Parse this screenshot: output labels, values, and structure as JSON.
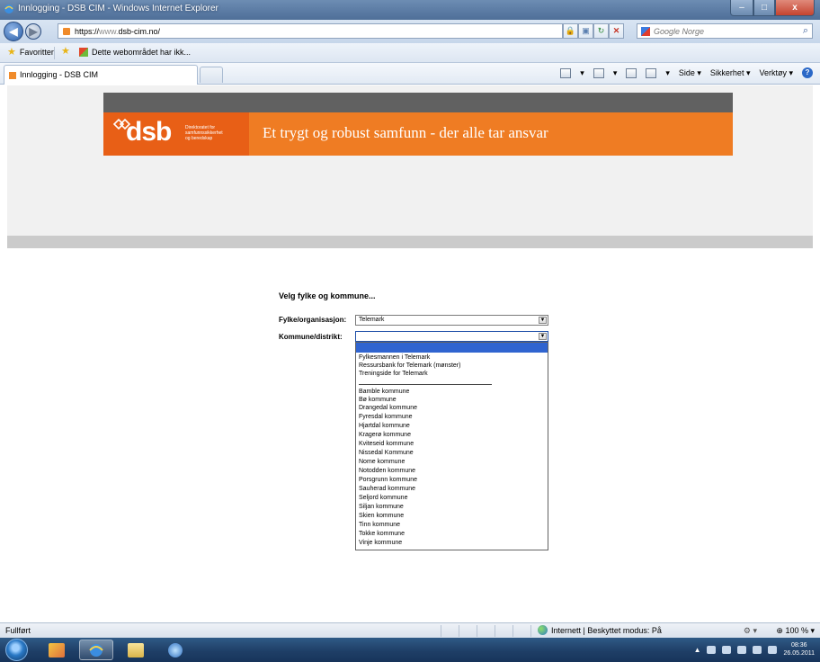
{
  "window": {
    "title": "Innlogging - DSB CIM - Windows Internet Explorer",
    "controls": {
      "minimize": "–",
      "maximize": "□",
      "close": "x"
    }
  },
  "address_bar": {
    "url_protocol": "https://",
    "url_www": "www.",
    "url_domain": "dsb-cim.no/",
    "search_placeholder": "Google Norge"
  },
  "favorites_bar": {
    "favorites_label": "Favoritter",
    "link_label": "Dette webområdet har ikk..."
  },
  "tab": {
    "label": "Innlogging - DSB CIM"
  },
  "command_bar": {
    "page_label": "Side ▾",
    "safety_label": "Sikkerhet ▾",
    "tools_label": "Verktøy ▾"
  },
  "page": {
    "logo_text": "dsb",
    "logo_subtitle": [
      "Direktoratet for",
      "samfunnssikkerhet",
      "og beredskap"
    ],
    "slogan": "Et trygt og robust samfunn - der alle tar ansvar",
    "form_heading": "Velg fylke og kommune...",
    "fylke_label": "Fylke/organisasjon:",
    "fylke_value": "Telemark",
    "kommune_label": "Kommune/distrikt:",
    "kommune_value": "",
    "kommune_options": [
      "Fylkesmannen i Telemark",
      "Ressursbank for Telemark (mønster)",
      "Treningside for Telemark",
      "Bamble kommune",
      "Bø kommune",
      "Drangedal kommune",
      "Fyresdal kommune",
      "Hjartdal kommune",
      "Kragerø kommune",
      "Kviteseid kommune",
      "Nissedal Kommune",
      "Nome kommune",
      "Notodden kommune",
      "Porsgrunn kommune",
      "Sauherad kommune",
      "Seljord kommune",
      "Siljan kommune",
      "Skien kommune",
      "Tinn kommune",
      "Tokke kommune",
      "Vinje kommune"
    ]
  },
  "status_bar": {
    "status": "Fullført",
    "zone": "Internett | Beskyttet modus: På",
    "zoom": "100 %"
  },
  "taskbar": {
    "time": "08:36",
    "date": "26.05.2011"
  },
  "colors": {
    "banner_orange": "#ef7c23",
    "logo_orange": "#e85f16",
    "header_dark": "#616161",
    "dropdown_highlight": "#3064d0"
  }
}
